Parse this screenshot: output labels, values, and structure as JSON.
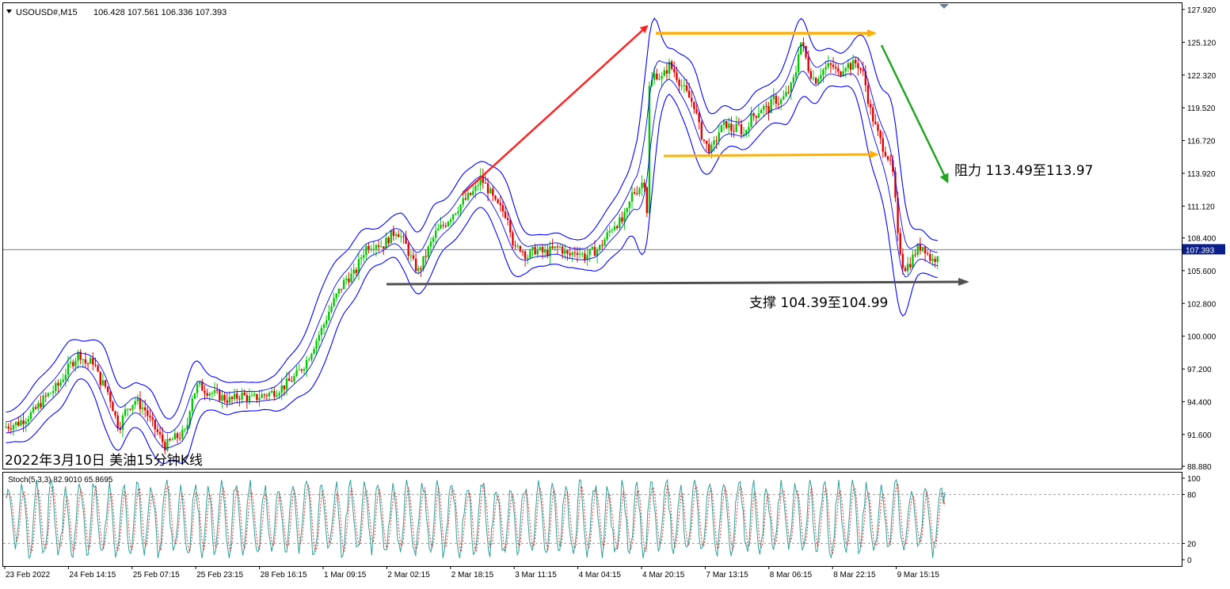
{
  "chart_data": [
    {
      "type": "candlestick",
      "title": "USOUSD#,M15",
      "ohlc_header": "106.428 107.561 106.336 107.393",
      "caption": "2022年3月10日 美油15分钟K线",
      "current_price_label": "107.393",
      "current_price": 107.393,
      "ylim": [
        88.88,
        127.92
      ],
      "y_ticks": [
        "127.920",
        "125.120",
        "122.320",
        "119.520",
        "116.720",
        "113.920",
        "111.120",
        "108.400",
        "105.600",
        "102.800",
        "100.000",
        "97.200",
        "94.400",
        "91.600",
        "88.880"
      ],
      "x_ticks": [
        "23 Feb 2022",
        "24 Feb 14:15",
        "25 Feb 07:15",
        "25 Feb 23:15",
        "28 Feb 16:15",
        "1 Mar 09:15",
        "2 Mar 02:15",
        "2 Mar 18:15",
        "3 Mar 11:15",
        "4 Mar 04:15",
        "4 Mar 20:15",
        "7 Mar 13:15",
        "8 Mar 06:15",
        "8 Mar 22:15",
        "9 Mar 15:15"
      ],
      "price_path": [
        [
          0,
          92.2
        ],
        [
          1.5,
          92.6
        ],
        [
          3,
          93.5
        ],
        [
          4,
          94.6
        ],
        [
          5.5,
          95.8
        ],
        [
          6.5,
          97.3
        ],
        [
          7.6,
          98.6
        ],
        [
          8.3,
          97.6
        ],
        [
          9,
          97.9
        ],
        [
          9.6,
          96.3
        ],
        [
          10.3,
          95.6
        ],
        [
          10.8,
          94.4
        ],
        [
          11.3,
          92.8
        ],
        [
          11.6,
          92.2
        ],
        [
          12.3,
          93.8
        ],
        [
          13.2,
          94.5
        ],
        [
          14.2,
          93.7
        ],
        [
          14.8,
          92.6
        ],
        [
          15.4,
          91.8
        ],
        [
          16.2,
          90.6
        ],
        [
          17,
          91.2
        ],
        [
          18.3,
          91.8
        ],
        [
          18.8,
          94.7
        ],
        [
          19.5,
          95.8
        ],
        [
          20.5,
          95.3
        ],
        [
          21.8,
          94.8
        ],
        [
          22.8,
          94.5
        ],
        [
          23.8,
          95.0
        ],
        [
          24.8,
          94.6
        ],
        [
          25.8,
          94.9
        ],
        [
          27,
          95.2
        ],
        [
          28.2,
          95.8
        ],
        [
          29.3,
          96.6
        ],
        [
          30.3,
          97.8
        ],
        [
          31.2,
          99.4
        ],
        [
          32,
          100.8
        ],
        [
          32.7,
          102.3
        ],
        [
          33.4,
          103.5
        ],
        [
          34.3,
          104.9
        ],
        [
          35.2,
          105.3
        ],
        [
          35.8,
          106.7
        ],
        [
          36.3,
          107.6
        ],
        [
          37.3,
          108.0
        ],
        [
          38,
          107.7
        ],
        [
          38.7,
          108.5
        ],
        [
          39.4,
          109.1
        ],
        [
          40.3,
          107.8
        ],
        [
          41,
          106.3
        ],
        [
          41.6,
          105.5
        ],
        [
          42.4,
          107.1
        ],
        [
          43.3,
          108.8
        ],
        [
          44.2,
          109.6
        ],
        [
          45.2,
          110.7
        ],
        [
          46.2,
          111.6
        ],
        [
          47.2,
          112.4
        ],
        [
          47.8,
          113.5
        ],
        [
          48.6,
          112.5
        ],
        [
          49.3,
          111.3
        ],
        [
          49.9,
          110.8
        ],
        [
          50.6,
          110.2
        ],
        [
          51.2,
          107.3
        ],
        [
          51.8,
          107.6
        ],
        [
          52.5,
          106.8
        ],
        [
          53.3,
          107.4
        ],
        [
          54.2,
          107.1
        ],
        [
          55.1,
          107.4
        ],
        [
          55.8,
          107.6
        ],
        [
          56.6,
          106.8
        ],
        [
          57.4,
          107.4
        ],
        [
          58.2,
          106.8
        ],
        [
          59,
          107.2
        ],
        [
          59.7,
          107.5
        ],
        [
          60.4,
          108.5
        ],
        [
          61.2,
          109.6
        ],
        [
          62,
          109.8
        ],
        [
          62.5,
          110.6
        ],
        [
          63,
          112.2
        ],
        [
          63.6,
          112.6
        ],
        [
          64.2,
          113.4
        ],
        [
          64.5,
          110.5
        ],
        [
          64.7,
          121.2
        ],
        [
          65.3,
          122.5
        ],
        [
          66,
          122.0
        ],
        [
          66.7,
          123.2
        ],
        [
          67.3,
          122.5
        ],
        [
          67.9,
          121.5
        ],
        [
          68.6,
          120.5
        ],
        [
          69.2,
          119.8
        ],
        [
          69.8,
          117.5
        ],
        [
          70.4,
          116.3
        ],
        [
          71,
          115.9
        ],
        [
          71.7,
          117.5
        ],
        [
          72.4,
          118.2
        ],
        [
          73,
          117.6
        ],
        [
          73.7,
          117.9
        ],
        [
          74.2,
          117.2
        ],
        [
          74.8,
          118.6
        ],
        [
          75.4,
          119.0
        ],
        [
          76,
          119.6
        ],
        [
          76.6,
          119.3
        ],
        [
          77.2,
          120.3
        ],
        [
          77.8,
          120.0
        ],
        [
          78.4,
          120.6
        ],
        [
          79,
          121.4
        ],
        [
          79.4,
          122.6
        ],
        [
          79.8,
          125.4
        ],
        [
          80.2,
          124.4
        ],
        [
          80.7,
          122.8
        ],
        [
          81.3,
          121.8
        ],
        [
          81.9,
          122.6
        ],
        [
          82.5,
          123.0
        ],
        [
          83.1,
          123.1
        ],
        [
          83.7,
          122.3
        ],
        [
          84.3,
          123.3
        ],
        [
          84.9,
          123.1
        ],
        [
          85.5,
          123.4
        ],
        [
          86.2,
          122.3
        ],
        [
          86.8,
          119.5
        ],
        [
          87.4,
          117.8
        ],
        [
          88,
          116.4
        ],
        [
          88.6,
          115.4
        ],
        [
          89.2,
          113.6
        ],
        [
          89.6,
          108.5
        ],
        [
          90.2,
          105.8
        ],
        [
          90.8,
          106.2
        ],
        [
          91.5,
          107.4
        ],
        [
          92.2,
          107.8
        ],
        [
          92.7,
          106.8
        ],
        [
          93.2,
          106.4
        ],
        [
          93.6,
          107.2
        ]
      ],
      "annotations": [
        {
          "text": "阻力 113.49至113.97",
          "low": 113.49,
          "high": 113.97
        },
        {
          "text": "支撑 104.39至104.99",
          "low": 104.39,
          "high": 104.99
        }
      ]
    },
    {
      "type": "line",
      "title": "Stoch(5,3,3) 82.9010 65.8695",
      "ylim": [
        0,
        100
      ],
      "y_ticks": [
        "100",
        "80",
        "20",
        "0"
      ],
      "levels": [
        80,
        20
      ],
      "cycles": 66,
      "last_main": 82.901,
      "last_signal": 65.8695
    }
  ],
  "colors": {
    "bull": "#00c800",
    "bear": "#e10000",
    "band": "#0000ff",
    "price_line": "#6f8090",
    "up_arrow": "#ff2020",
    "down_arrow": "#1fa51f",
    "level_arrow": "#ffb000",
    "support_arrow": "#505050",
    "stoch_main": "#2aa198",
    "stoch_signal": "#e03030"
  }
}
